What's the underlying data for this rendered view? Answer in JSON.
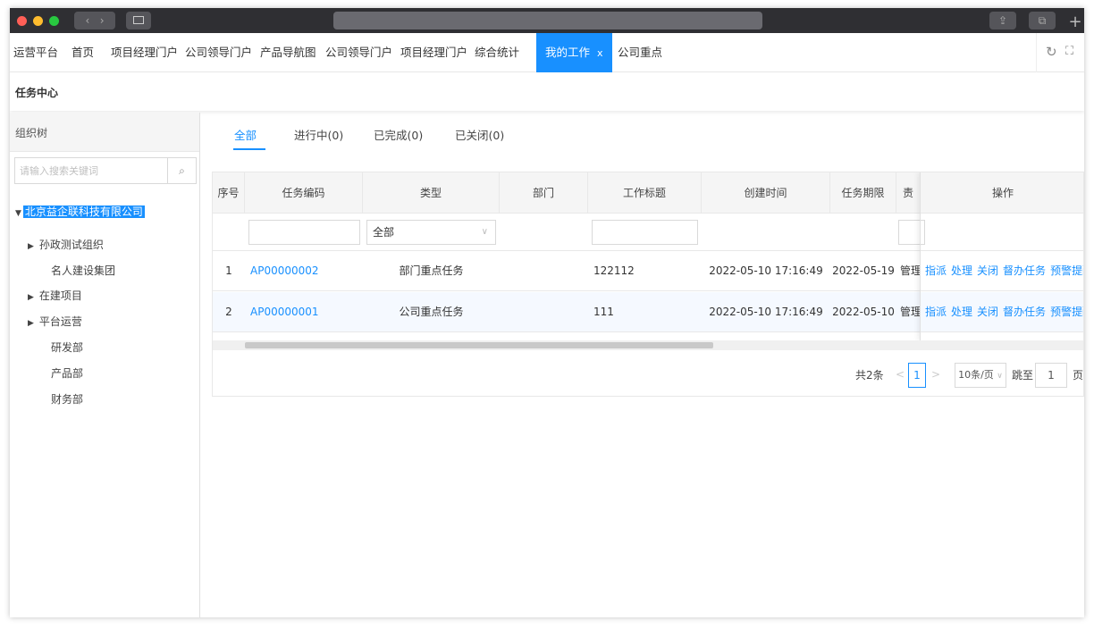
{
  "window": {
    "traffic_lights": [
      "#ff5f57",
      "#febc2e",
      "#28c840"
    ]
  },
  "nav_tabs": [
    {
      "label": "运营平台"
    },
    {
      "label": "首页"
    },
    {
      "label": "项目经理门户"
    },
    {
      "label": "公司领导门户"
    },
    {
      "label": "产品导航图"
    },
    {
      "label": "公司领导门户"
    },
    {
      "label": "项目经理门户"
    },
    {
      "label": "综合统计"
    },
    {
      "label": "我的工作",
      "active": true,
      "close": "x"
    },
    {
      "label": "公司重点"
    }
  ],
  "tab_tools": [
    "refresh-icon",
    "fullscreen-icon"
  ],
  "breadcrumb": "任务中心",
  "sidebar": {
    "title": "组织树",
    "search_placeholder": "请输入搜索关键词",
    "root": "北京益企联科技有限公司",
    "items": [
      {
        "label": "孙政测试组织",
        "expandable": true
      },
      {
        "label": "名人建设集团",
        "expandable": false
      },
      {
        "label": "在建项目",
        "expandable": true
      },
      {
        "label": "平台运营",
        "expandable": true
      },
      {
        "label": "研发部",
        "expandable": false
      },
      {
        "label": "产品部",
        "expandable": false
      },
      {
        "label": "财务部",
        "expandable": false
      }
    ]
  },
  "subtabs": [
    "全部",
    "进行中(0)",
    "已完成(0)",
    "已关闭(0)"
  ],
  "table": {
    "headers": [
      "序号",
      "任务编码",
      "类型",
      "部门",
      "工作标题",
      "创建时间",
      "任务期限",
      "责",
      "操作"
    ],
    "type_filter": "全部",
    "rows": [
      {
        "no": "1",
        "code": "AP00000002",
        "type": "部门重点任务",
        "dept": "",
        "title": "122112",
        "created": "2022-05-10 17:16:49",
        "deadline": "2022-05-19",
        "owner": "管理"
      },
      {
        "no": "2",
        "code": "AP00000001",
        "type": "公司重点任务",
        "dept": "",
        "title": "111",
        "created": "2022-05-10 17:16:49",
        "deadline": "2022-05-10",
        "owner": "管理"
      }
    ],
    "actions": [
      "指派",
      "处理",
      "关闭",
      "督办任务",
      "预警提醒"
    ]
  },
  "pagination": {
    "total": "共2条",
    "prev": "<",
    "current": "1",
    "next": ">",
    "page_size": "10条/页",
    "jump_label": "跳至",
    "jump_value": "1",
    "page_unit": "页"
  }
}
